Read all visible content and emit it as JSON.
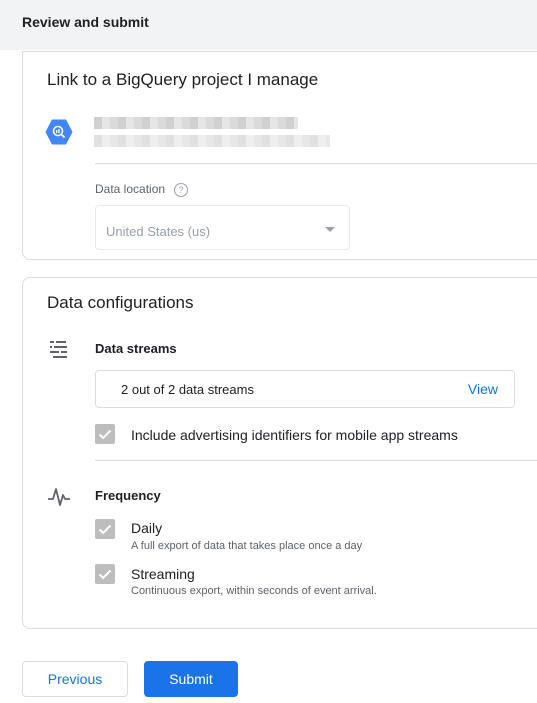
{
  "header": {
    "title": "Review and submit"
  },
  "bigquery_card": {
    "title": "Link to a BigQuery project I manage",
    "project_icon": "bigquery-hexagon-icon",
    "data_location_label": "Data location",
    "help_icon_glyph": "?",
    "data_location_value": "United States (us)"
  },
  "config_card": {
    "title": "Data configurations",
    "streams": {
      "icon": "data-streams-icon",
      "title": "Data streams",
      "summary": "2 out of 2 data streams",
      "view_label": "View",
      "ad_ids_label": "Include advertising identifiers for mobile app streams",
      "ad_ids_checked": true
    },
    "frequency": {
      "icon": "pulse-icon",
      "title": "Frequency",
      "daily_label": "Daily",
      "daily_desc": "A full export of data that takes place once a day",
      "daily_checked": true,
      "streaming_label": "Streaming",
      "streaming_desc": "Continuous export, within seconds of event arrival.",
      "streaming_checked": true
    }
  },
  "actions": {
    "previous_label": "Previous",
    "submit_label": "Submit"
  },
  "colors": {
    "accent": "#1a73e8",
    "header_bg": "#f1f3f4",
    "border": "#dadce0",
    "checkbox_disabled": "#bdbdbd"
  }
}
